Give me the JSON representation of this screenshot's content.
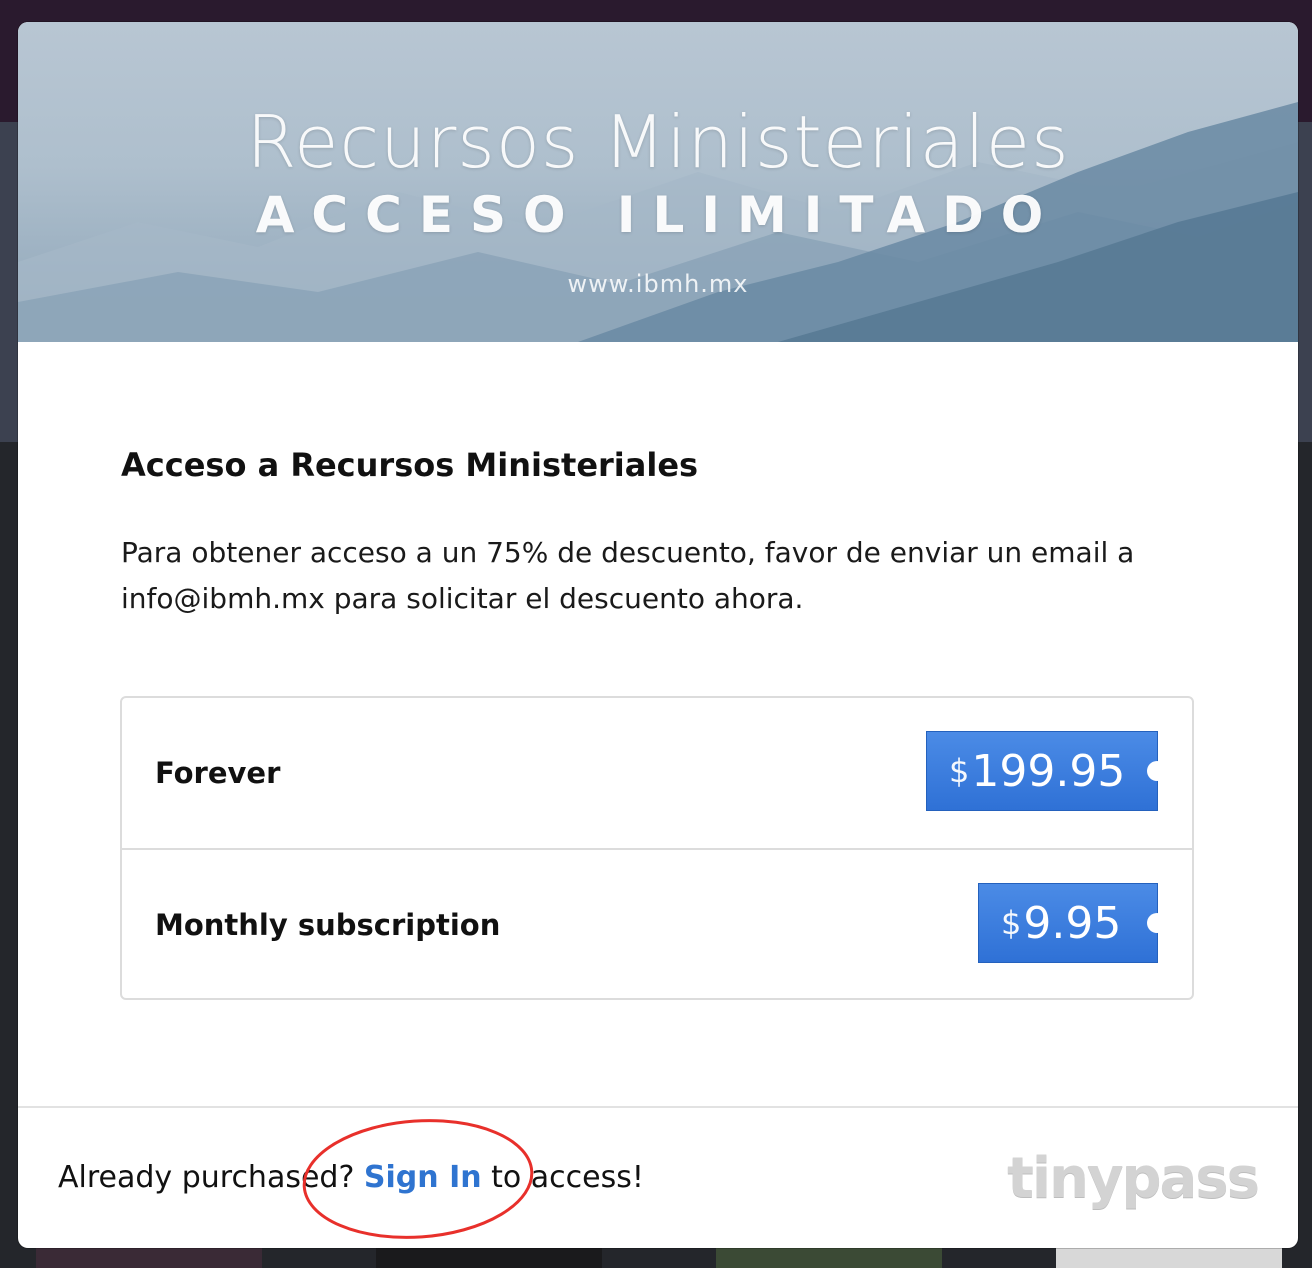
{
  "banner": {
    "title": "Recursos Ministeriales",
    "subtitle": "ACCESO ILIMITADO",
    "url": "www.ibmh.mx"
  },
  "heading": "Acceso a Recursos Ministeriales",
  "description": "Para obtener acceso a un 75% de descuento, favor de enviar un email a info@ibmh.mx para solicitar el descuento ahora.",
  "options": [
    {
      "label": "Forever",
      "currency": "$",
      "amount": "199.95"
    },
    {
      "label": "Monthly subscription",
      "currency": "$",
      "amount": "9.95"
    }
  ],
  "footer": {
    "prefix": "Already purchased? ",
    "signin_label": "Sign In",
    "suffix": " to access!",
    "logo_text": "tinypass"
  },
  "colors": {
    "button": "#3a7ddc",
    "link": "#2f74d0",
    "annotation": "#e8302b"
  }
}
